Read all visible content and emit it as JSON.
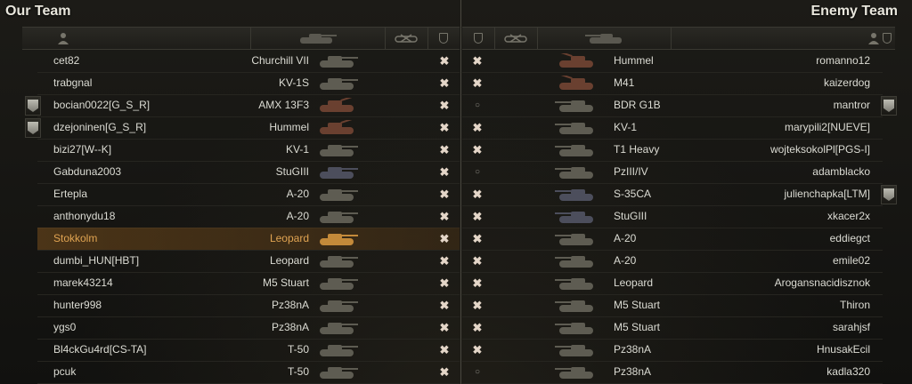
{
  "titles": {
    "our_team": "Our Team",
    "enemy_team": "Enemy Team"
  },
  "icons": {
    "player": "user-icon",
    "vehicle": "tank-icon",
    "frags": "frags-icon",
    "badge": "badge-icon",
    "status_destroyed": "✖",
    "status_alive": "○"
  },
  "colors": {
    "highlight": "#e0a452",
    "vehicle_light": "#5e5c52",
    "vehicle_arty": "#6a4030",
    "vehicle_self": "#c48a3a"
  },
  "our_team": [
    {
      "player": "cet82",
      "vehicle": "Churchill VII",
      "status": "✖",
      "tank_class": "heavy",
      "badge": false
    },
    {
      "player": "trabgnal",
      "vehicle": "KV-1S",
      "status": "✖",
      "tank_class": "heavy",
      "badge": false
    },
    {
      "player": "bocian0022[G_S_R]",
      "vehicle": "AMX 13F3",
      "status": "✖",
      "tank_class": "arty",
      "badge": true
    },
    {
      "player": "dzejoninen[G_S_R]",
      "vehicle": "Hummel",
      "status": "✖",
      "tank_class": "arty",
      "badge": true
    },
    {
      "player": "bizi27[W--K]",
      "vehicle": "KV-1",
      "status": "✖",
      "tank_class": "heavy",
      "badge": false
    },
    {
      "player": "Gabduna2003",
      "vehicle": "StuGIII",
      "status": "✖",
      "tank_class": "td",
      "badge": false
    },
    {
      "player": "Ertepla",
      "vehicle": "A-20",
      "status": "✖",
      "tank_class": "light",
      "badge": false
    },
    {
      "player": "anthonydu18",
      "vehicle": "A-20",
      "status": "✖",
      "tank_class": "light",
      "badge": false
    },
    {
      "player": "Stokkolm",
      "vehicle": "Leopard",
      "status": "✖",
      "tank_class": "self",
      "badge": false,
      "highlight": true
    },
    {
      "player": "dumbi_HUN[HBT]",
      "vehicle": "Leopard",
      "status": "✖",
      "tank_class": "light",
      "badge": false
    },
    {
      "player": "marek43214",
      "vehicle": "M5 Stuart",
      "status": "✖",
      "tank_class": "light",
      "badge": false
    },
    {
      "player": "hunter998",
      "vehicle": "Pz38nA",
      "status": "✖",
      "tank_class": "light",
      "badge": false
    },
    {
      "player": "ygs0",
      "vehicle": "Pz38nA",
      "status": "✖",
      "tank_class": "light",
      "badge": false
    },
    {
      "player": "Bl4ckGu4rd[CS-TA]",
      "vehicle": "T-50",
      "status": "✖",
      "tank_class": "light",
      "badge": false
    },
    {
      "player": "pcuk",
      "vehicle": "T-50",
      "status": "✖",
      "tank_class": "light",
      "badge": false
    }
  ],
  "enemy_team": [
    {
      "player": "romanno12",
      "vehicle": "Hummel",
      "status": "✖",
      "tank_class": "arty",
      "badge": false
    },
    {
      "player": "kaizerdog",
      "vehicle": "M41",
      "status": "✖",
      "tank_class": "arty",
      "badge": false
    },
    {
      "player": "mantror",
      "vehicle": "BDR G1B",
      "status": "○",
      "tank_class": "heavy",
      "badge": true
    },
    {
      "player": "marypili2[NUEVE]",
      "vehicle": "KV-1",
      "status": "✖",
      "tank_class": "heavy",
      "badge": false
    },
    {
      "player": "wojteksokolPl[PGS-I]",
      "vehicle": "T1 Heavy",
      "status": "✖",
      "tank_class": "heavy",
      "badge": false
    },
    {
      "player": "adamblacko",
      "vehicle": "PzIII/IV",
      "status": "○",
      "tank_class": "light",
      "badge": false
    },
    {
      "player": "julienchapka[LTM]",
      "vehicle": "S-35CA",
      "status": "✖",
      "tank_class": "td",
      "badge": true
    },
    {
      "player": "xkacer2x",
      "vehicle": "StuGIII",
      "status": "✖",
      "tank_class": "td",
      "badge": false
    },
    {
      "player": "eddiegct",
      "vehicle": "A-20",
      "status": "✖",
      "tank_class": "light",
      "badge": false
    },
    {
      "player": "emile02",
      "vehicle": "A-20",
      "status": "✖",
      "tank_class": "light",
      "badge": false
    },
    {
      "player": "Arogansnacidisznok",
      "vehicle": "Leopard",
      "status": "✖",
      "tank_class": "light",
      "badge": false
    },
    {
      "player": "Thiron",
      "vehicle": "M5 Stuart",
      "status": "✖",
      "tank_class": "light",
      "badge": false
    },
    {
      "player": "sarahjsf",
      "vehicle": "M5 Stuart",
      "status": "✖",
      "tank_class": "light",
      "badge": false
    },
    {
      "player": "HnusakEcil",
      "vehicle": "Pz38nA",
      "status": "✖",
      "tank_class": "light",
      "badge": false
    },
    {
      "player": "kadla320",
      "vehicle": "Pz38nA",
      "status": "○",
      "tank_class": "light",
      "badge": false
    }
  ]
}
